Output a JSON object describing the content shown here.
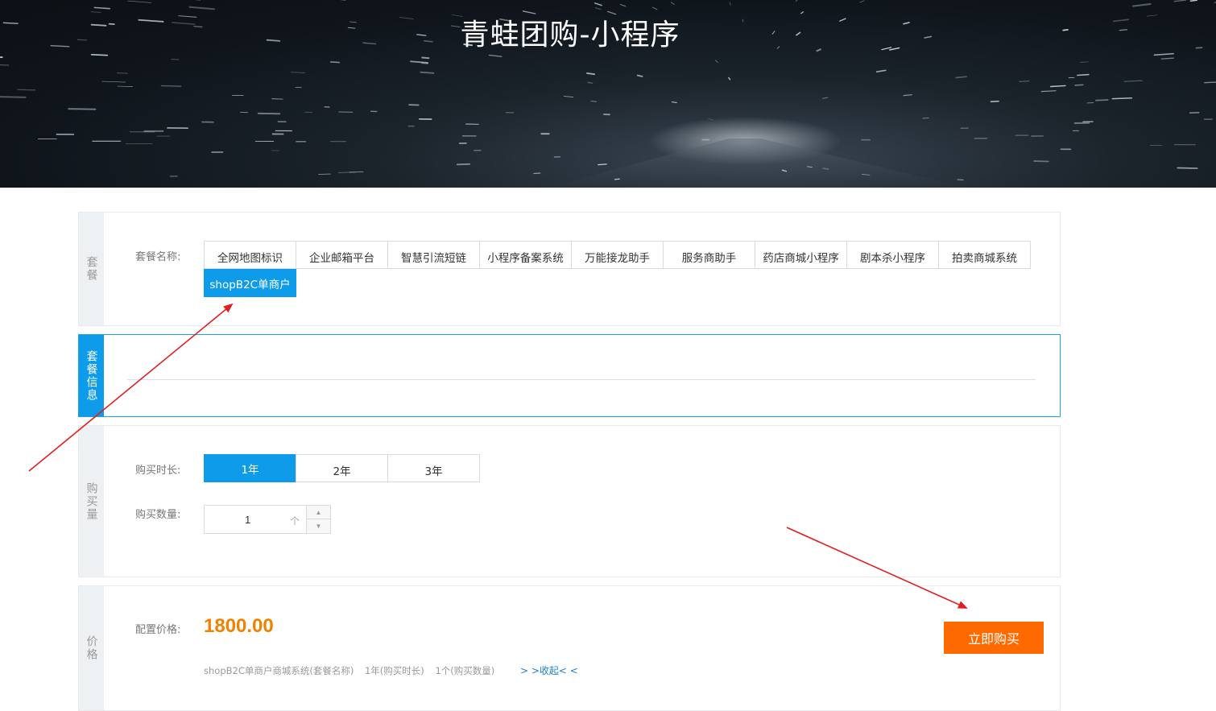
{
  "banner": {
    "title": "青蛙团购-小程序"
  },
  "package_panel": {
    "side_label": "套餐",
    "row_label": "套餐名称:",
    "options": [
      "全网地图标识",
      "企业邮箱平台",
      "智慧引流短链",
      "小程序备案系统",
      "万能接龙助手",
      "服务商助手",
      "药店商城小程序",
      "剧本杀小程序",
      "拍卖商城系统",
      "shopB2C单商户"
    ],
    "selected_index": 9
  },
  "info_panel": {
    "side_label": "套餐信息"
  },
  "quantity_panel": {
    "side_label": "购买量",
    "duration_label": "购买时长:",
    "durations": [
      "1年",
      "2年",
      "3年"
    ],
    "selected_duration": 0,
    "quantity_label": "购买数量:",
    "quantity_value": "1",
    "quantity_unit": "个"
  },
  "price_panel": {
    "side_label": "价格",
    "price_label": "配置价格:",
    "price": "1800.00",
    "summary_name": "shopB2C单商户商城系统(套餐名称)",
    "summary_duration": "1年(购买时长)",
    "summary_quantity": "1个(购买数量)",
    "collapse_link": "> >收起< <",
    "buy_button": "立即购买"
  },
  "colors": {
    "accent_blue": "#0e9bea",
    "buy_orange": "#ff6a00",
    "price_orange": "#f08200",
    "annotation_red": "#e02020"
  }
}
